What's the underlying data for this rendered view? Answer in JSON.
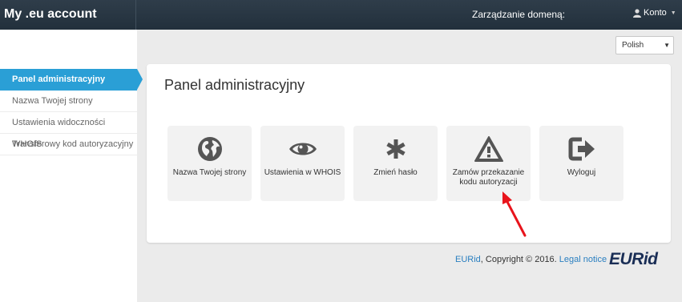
{
  "header": {
    "brand": "My .eu account",
    "domain_label": "Zarządzanie domeną:",
    "account_label": "Konto"
  },
  "sidebar": {
    "items": [
      {
        "label": "Panel administracyjny",
        "active": true
      },
      {
        "label": "Nazwa Twojej strony",
        "active": false
      },
      {
        "label": "Ustawienia widoczności WHOIS",
        "active": false
      },
      {
        "label": "Transferowy kod autoryzacyjny",
        "active": false
      }
    ]
  },
  "language": {
    "selected": "Polish"
  },
  "panel": {
    "title": "Panel administracyjny",
    "tiles": [
      {
        "label": "Nazwa Twojej strony",
        "icon": "globe-icon"
      },
      {
        "label": "Ustawienia w WHOIS",
        "icon": "eye-icon"
      },
      {
        "label": "Zmień hasło",
        "icon": "asterisk-icon"
      },
      {
        "label": "Zamów przekazanie kodu autoryzacji",
        "icon": "warning-icon"
      },
      {
        "label": "Wyloguj",
        "icon": "logout-icon"
      }
    ]
  },
  "footer": {
    "eurid_link": "EURid",
    "copyright": ", Copyright © 2016.",
    "legal": "Legal notice",
    "logo_main": "EUR",
    "logo_id": "id"
  },
  "colors": {
    "accent": "#2a9fd6",
    "topbar": "#263441",
    "annotation_arrow": "#e8141c"
  }
}
